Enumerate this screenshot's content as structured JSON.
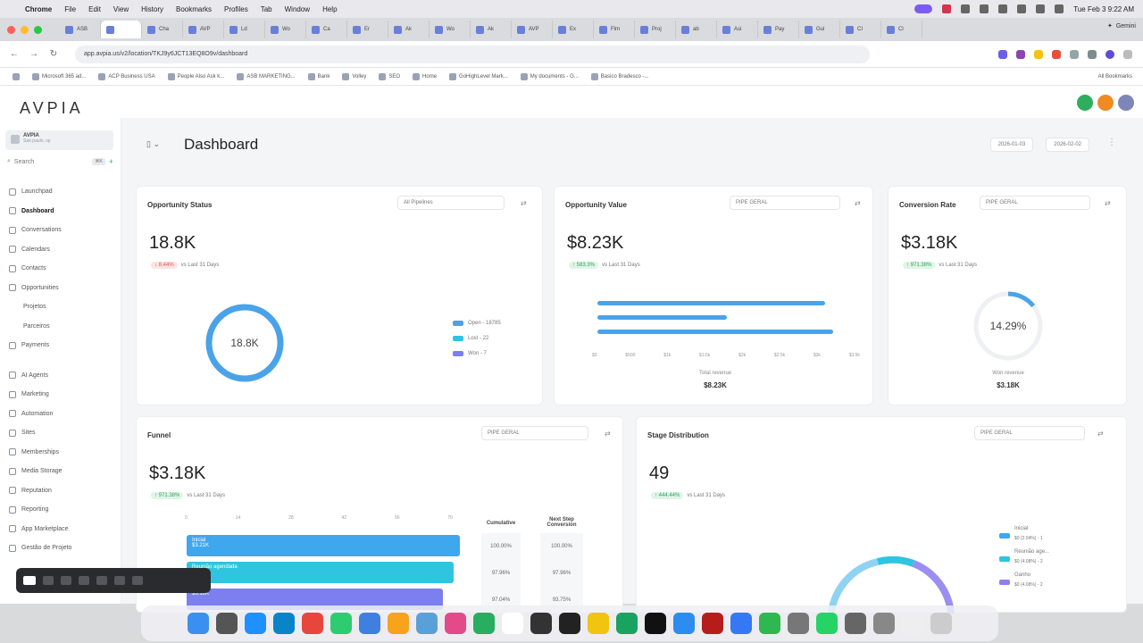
{
  "menubar": {
    "app": "Chrome",
    "items": [
      "File",
      "Edit",
      "View",
      "History",
      "Bookmarks",
      "Profiles",
      "Tab",
      "Window",
      "Help"
    ],
    "clock": "Tue Feb 3  9:22 AM"
  },
  "tabs": [
    "ASB",
    "",
    "Cha",
    "AVP",
    "Ld",
    "Wo",
    "Ca",
    "Er",
    "Ak",
    "Wo",
    "Ak",
    "AVP",
    "Ex",
    "Flm",
    "Proj",
    "ab",
    "Asi",
    "Pay",
    "Gui",
    "CI",
    "Cl"
  ],
  "gemini_label": "Gemini",
  "url": "app.avpia.us/v2/location/TKJ9y6JCT13EQ8O9v/dashboard",
  "bookmarks": [
    "Microsoft 365 ad...",
    "ACP Business USA",
    "People Also Ask k...",
    "ASB MARKETING...",
    "Bank",
    "Volley",
    "SEO",
    "Home",
    "GoHighLevel Mark...",
    "My documents - G...",
    "Basico Bradesco -..."
  ],
  "all_bookmarks": "All Bookmarks",
  "app": {
    "logo": "AVPIA",
    "account_name": "AVPIA",
    "account_sub": "Sao paulo, sp",
    "search_placeholder": "Search",
    "search_kbd": "⌘K",
    "nav": [
      {
        "label": "Launchpad",
        "active": false,
        "sub": false,
        "gap": false
      },
      {
        "label": "Dashboard",
        "active": true,
        "sub": false,
        "gap": false
      },
      {
        "label": "Conversations",
        "active": false,
        "sub": false,
        "gap": false
      },
      {
        "label": "Calendars",
        "active": false,
        "sub": false,
        "gap": false
      },
      {
        "label": "Contacts",
        "active": false,
        "sub": false,
        "gap": false
      },
      {
        "label": "Opportunities",
        "active": false,
        "sub": false,
        "gap": false
      },
      {
        "label": "Projetos",
        "active": false,
        "sub": true,
        "gap": false
      },
      {
        "label": "Parceiros",
        "active": false,
        "sub": true,
        "gap": false
      },
      {
        "label": "Payments",
        "active": false,
        "sub": false,
        "gap": false
      },
      {
        "label": "AI Agents",
        "active": false,
        "sub": false,
        "gap": true
      },
      {
        "label": "Marketing",
        "active": false,
        "sub": false,
        "gap": false
      },
      {
        "label": "Automation",
        "active": false,
        "sub": false,
        "gap": false
      },
      {
        "label": "Sites",
        "active": false,
        "sub": false,
        "gap": false
      },
      {
        "label": "Memberships",
        "active": false,
        "sub": false,
        "gap": false
      },
      {
        "label": "Media Storage",
        "active": false,
        "sub": false,
        "gap": false
      },
      {
        "label": "Reputation",
        "active": false,
        "sub": false,
        "gap": false
      },
      {
        "label": "Reporting",
        "active": false,
        "sub": false,
        "gap": false
      },
      {
        "label": "App Marketplace",
        "active": false,
        "sub": false,
        "gap": false
      },
      {
        "label": "Gestão de Projeto",
        "active": false,
        "sub": false,
        "gap": false
      }
    ],
    "page_title": "Dashboard",
    "date_start": "2026-01-03",
    "date_end": "2026-02-02"
  },
  "cards": {
    "opportunity_status": {
      "title": "Opportunity Status",
      "select": "All Pipelines",
      "value": "18.8K",
      "delta": "↓ 8.44%",
      "delta_suffix": "vs Last 31 Days",
      "donut_label": "18.8K",
      "legend": [
        {
          "label": "Open - 18785",
          "color": "#4aa3e8"
        },
        {
          "label": "Lost - 22",
          "color": "#2fc4e0"
        },
        {
          "label": "Won - 7",
          "color": "#7b7ff0"
        }
      ]
    },
    "opportunity_value": {
      "title": "Opportunity Value",
      "select": "PIPE GERAL",
      "value": "$8.23K",
      "delta": "↑ 583.3%",
      "delta_suffix": "vs Last 31 Days",
      "bars_fraction": [
        0.88,
        0.5,
        0.91
      ],
      "bar_color": "#4aa3e8",
      "axis": [
        "$0",
        "$500",
        "$1k",
        "$1.5k",
        "$2k",
        "$2.5k",
        "$3k",
        "$3.5k"
      ],
      "total_label": "Total revenue",
      "total_value": "$8.23K"
    },
    "conversion_rate": {
      "title": "Conversion Rate",
      "select": "PIPE GERAL",
      "value": "$3.18K",
      "delta": "↑ 971.38%",
      "delta_suffix": "vs Last 31 Days",
      "gauge_label": "14.29%",
      "gauge_fraction": 0.1429,
      "sub_label": "Won revenue",
      "sub_value": "$3.18K"
    },
    "funnel": {
      "title": "Funnel",
      "select": "PIPE GERAL",
      "value": "$3.18K",
      "delta": "↑ 971.38%",
      "delta_suffix": "vs Last 31 Days",
      "axis": [
        "0",
        "14",
        "28",
        "42",
        "56",
        "70"
      ],
      "bars": [
        {
          "label": "Inicial",
          "sub": "$3.21K",
          "fraction": 0.97,
          "color": "#3ea7ee"
        },
        {
          "label": "Reunião agendada",
          "sub": "",
          "fraction": 0.95,
          "color": "#2fc4e0"
        },
        {
          "label": "",
          "sub": "$3.18K",
          "fraction": 0.91,
          "color": "#7b7ff0"
        }
      ],
      "col1_head": "Cumulative",
      "col2_head": "Next Step Conversion",
      "col1": [
        "100.00%",
        "97.96%",
        "97.04%"
      ],
      "col2": [
        "100.00%",
        "97.96%",
        "93.75%"
      ]
    },
    "stage_distribution": {
      "title": "Stage Distribution",
      "select": "PIPE GERAL",
      "value": "49",
      "delta": "↑ 444.44%",
      "delta_suffix": "vs Last 31 Days",
      "legend": [
        {
          "label": "Inicial",
          "sub": "$0 (2.04%) - 1",
          "color": "#3ea7ee"
        },
        {
          "label": "Reunião age...",
          "sub": "$0 (4.08%) - 2",
          "color": "#2fc4e0"
        },
        {
          "label": "Ganho",
          "sub": "$0 (4.08%) - 2",
          "color": "#8d7ff0"
        }
      ]
    }
  },
  "colors": {
    "primary": "#4aa3e8",
    "cyan": "#2fc4e0",
    "purple": "#7b7ff0"
  }
}
